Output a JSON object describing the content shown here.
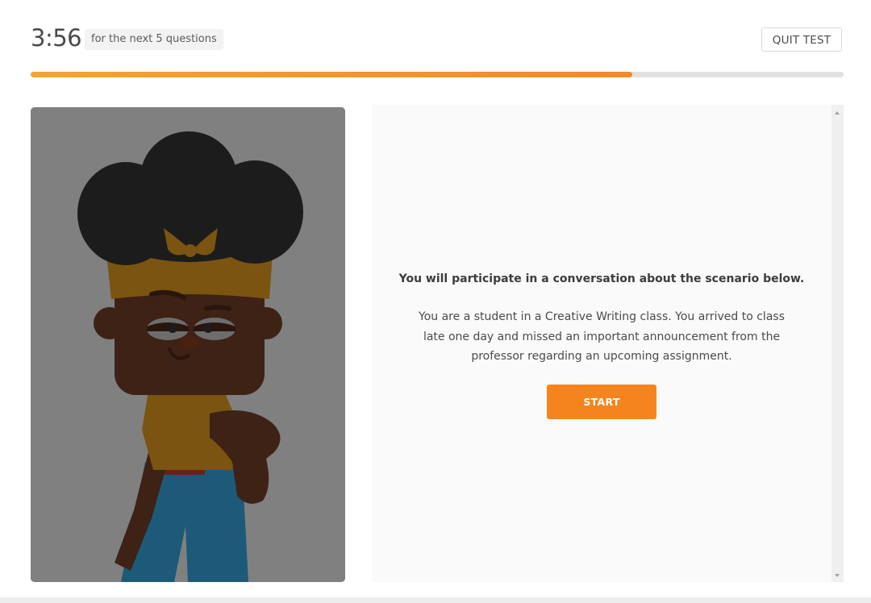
{
  "header": {
    "timer": "3:56",
    "timer_note": "for the next 5 questions",
    "quit_label": "QUIT TEST"
  },
  "progress": {
    "fraction": 0.74
  },
  "panel": {
    "intro": "You will participate in a conversation about the scenario below.",
    "scenario": "You are a student in a Creative Writing class. You arrived to class late one day and missed an important announcement from the professor regarding an upcoming assignment.",
    "start_label": "START"
  },
  "colors": {
    "accent": "#f5841f",
    "progress_start": "#f2a531",
    "progress_end": "#f08a2c",
    "illustration_bg": "#808080"
  }
}
